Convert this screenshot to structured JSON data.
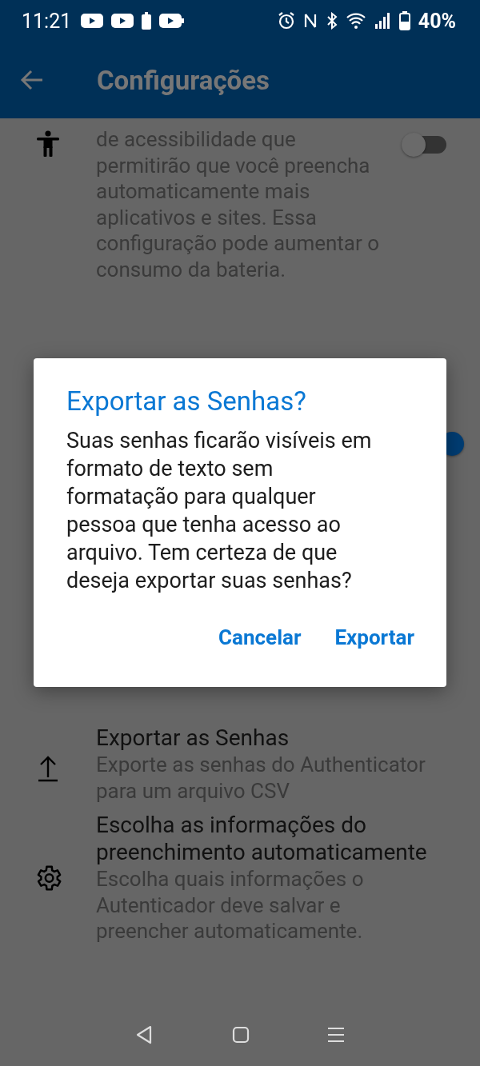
{
  "status_bar": {
    "time": "11:21",
    "battery": "40%"
  },
  "app_bar": {
    "title": "Configurações"
  },
  "settings": [
    {
      "kind": "toggle",
      "description": "de acessibilidade que permitirão que você preencha automaticamente mais aplicativos e sites. Essa configuração pode aumentar o consumo da bateria.",
      "on": false
    },
    {
      "kind": "hidden",
      "on": true
    },
    {
      "kind": "action",
      "title": "Exportar as Senhas",
      "description": "Exporte as senhas do Authenticator para um arquivo CSV"
    },
    {
      "kind": "action",
      "title": "Escolha as informações do preenchimento automaticamente",
      "description": "Escolha quais informações o Autenticador deve salvar e preencher automaticamente."
    }
  ],
  "dialog": {
    "title": "Exportar as Senhas?",
    "message": "Suas senhas ficarão visíveis em formato de texto sem formatação para qualquer pessoa que tenha acesso ao arquivo. Tem certeza de que deseja exportar suas senhas?",
    "buttons": [
      "Cancelar",
      "Exportar"
    ]
  }
}
